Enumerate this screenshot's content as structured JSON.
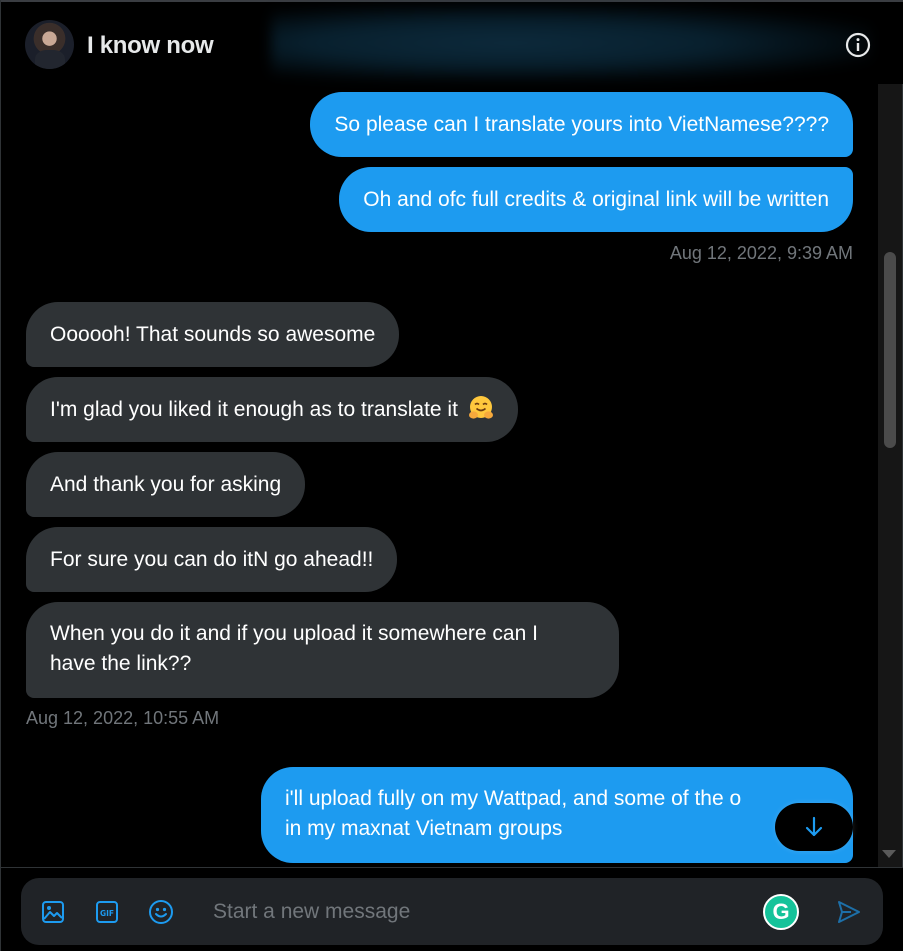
{
  "header": {
    "title": "I know now"
  },
  "messages": [
    {
      "side": "sent",
      "text": "So please can I translate yours into VietNamese????"
    },
    {
      "side": "sent",
      "text": "Oh and ofc full credits & original link will be written"
    },
    {
      "timestamp": "Aug 12, 2022, 9:39 AM"
    },
    {
      "side": "recv",
      "text": "Oooooh! That sounds so awesome"
    },
    {
      "side": "recv",
      "text": "I'm glad you liked it enough as to translate it",
      "emoji": "hugging-face"
    },
    {
      "side": "recv",
      "text": "And thank you for asking"
    },
    {
      "side": "recv",
      "text": "For sure you can do itN go ahead!!"
    },
    {
      "side": "recv",
      "text_lines": [
        "When you do it and if you upload it somewhere can I",
        "have the link??"
      ]
    },
    {
      "timestamp": "Aug 12, 2022, 10:55 AM"
    },
    {
      "side": "sent",
      "text_lines": [
        "i'll upload fully on my Wattpad, and some of the o",
        "in my maxnat Vietnam groups"
      ]
    }
  ],
  "composer": {
    "placeholder": "Start a new message",
    "icons": [
      "image-icon",
      "gif-icon",
      "emoji-icon",
      "grammarly-icon",
      "send-icon"
    ],
    "grammarly_letter": "G"
  },
  "colors": {
    "sent_bubble": "#1d9bf0",
    "recv_bubble": "#2f3336",
    "timestamp": "#71767b",
    "accent": "#1d9bf0"
  }
}
